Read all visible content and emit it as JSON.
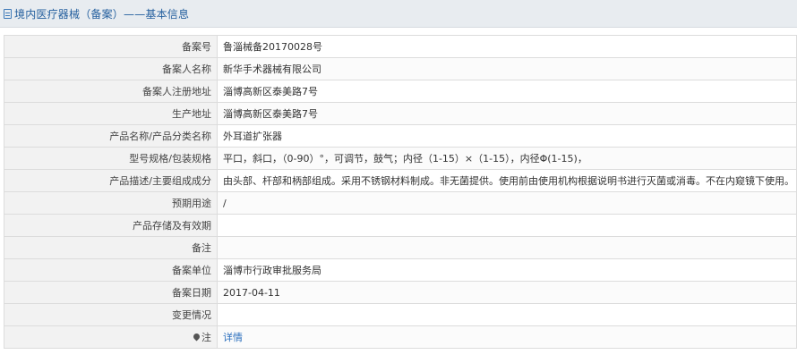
{
  "header": {
    "title": "境内医疗器械（备案）——基本信息"
  },
  "rows": [
    {
      "label": "备案号",
      "value": "鲁淄械备20170028号"
    },
    {
      "label": "备案人名称",
      "value": "新华手术器械有限公司"
    },
    {
      "label": "备案人注册地址",
      "value": "淄博高新区泰美路7号"
    },
    {
      "label": "生产地址",
      "value": "淄博高新区泰美路7号"
    },
    {
      "label": "产品名称/产品分类名称",
      "value": "外耳道扩张器"
    },
    {
      "label": "型号规格/包装规格",
      "value": "平口，斜口，（0-90）°，可调节，鼓气；内径（1-15）×（1-15），内径Φ(1-15)，"
    },
    {
      "label": "产品描述/主要组成成分",
      "value": "由头部、杆部和柄部组成。采用不锈钢材料制成。非无菌提供。使用前由使用机构根据说明书进行灭菌或消毒。不在内窥镜下使用。"
    },
    {
      "label": "预期用途",
      "value": "/"
    },
    {
      "label": "产品存储及有效期",
      "value": ""
    },
    {
      "label": "备注",
      "value": ""
    },
    {
      "label": "备案单位",
      "value": "淄博市行政审批服务局"
    },
    {
      "label": "备案日期",
      "value": "2017-04-11"
    },
    {
      "label": "变更情况",
      "value": ""
    }
  ],
  "note": {
    "label": "注",
    "link": "详情",
    "icon": "pin-icon"
  },
  "colors": {
    "title": "#245f9e",
    "link": "#2a6ebd",
    "label_bg": "#f2f2f2",
    "border": "#dcdcdc",
    "title_bg": "#e8ecf0"
  }
}
